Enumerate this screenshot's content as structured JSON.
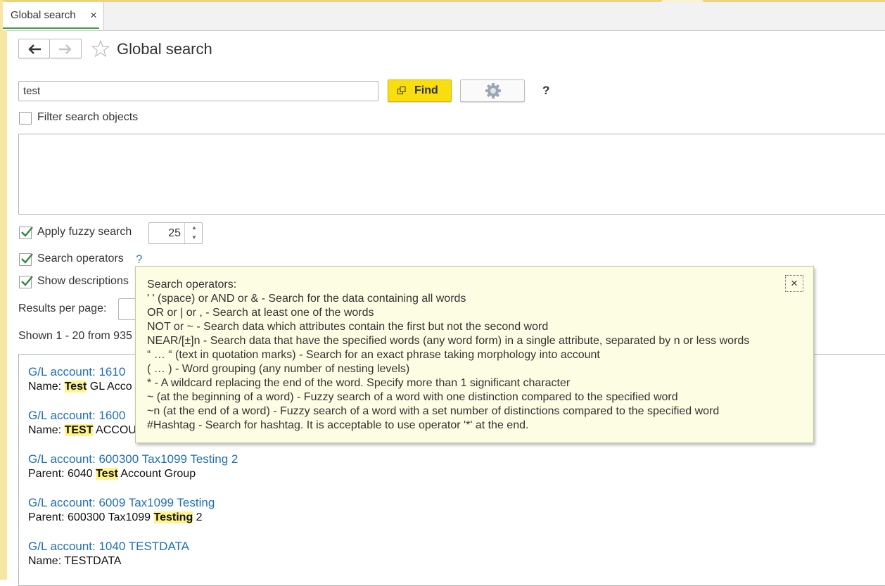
{
  "tab": {
    "label": "Global search",
    "close": "×"
  },
  "nav": {
    "back": "back-arrow",
    "forward": "forward-arrow"
  },
  "page": {
    "title": "Global search"
  },
  "search": {
    "value": "test",
    "find_label": "Find",
    "help": "?"
  },
  "filter": {
    "label": "Filter search objects",
    "checked": false
  },
  "fuzzy": {
    "label": "Apply fuzzy search",
    "checked": true,
    "value": "25"
  },
  "operators": {
    "label": "Search operators",
    "checked": true,
    "help": "?"
  },
  "descriptions": {
    "label": "Show descriptions",
    "checked": true
  },
  "results_per_page": {
    "label": "Results per page:"
  },
  "shown": {
    "text": "Shown 1 - 20 from 935"
  },
  "results": [
    {
      "title": "G/L account: 1610",
      "prefix": "Name: ",
      "highlight": "Test",
      "suffix": " GL Acco"
    },
    {
      "title": "G/L account: 1600",
      "prefix": "Name: ",
      "highlight": "TEST",
      "suffix": " ACCOU"
    },
    {
      "title": "G/L account: 600300 Tax1099 Testing 2",
      "prefix": "Parent: 6040 ",
      "highlight": "Test",
      "suffix": " Account Group"
    },
    {
      "title": "G/L account: 6009 Tax1099 Testing",
      "prefix": "Parent: 600300 Tax1099 ",
      "highlight": "Testing",
      "suffix": " 2"
    },
    {
      "title": "G/L account: 1040 TESTDATA",
      "prefix": "Name: TESTDATA",
      "highlight": "",
      "suffix": ""
    }
  ],
  "tooltip": {
    "close": "×",
    "lines": [
      "Search operators:",
      "' ' (space) or AND or & - Search for the data containing all words",
      "OR or | or , - Search at least one of the words",
      "NOT or ~ - Search data which attributes contain the first but not the second word",
      "NEAR/[±]n - Search data that have the specified words (any word form) in a single attribute, separated by n or less words",
      "“ … “ (text in quotation marks) - Search for an exact phrase taking morphology into account",
      "( … ) - Word grouping (any number of nesting levels)",
      "* - A wildcard replacing the end of the word. Specify more than 1 significant character",
      "~ (at the beginning of a word) - Fuzzy search of a word with one distinction compared to the specified word",
      "~n (at the end of a word) - Fuzzy search of a word with a set number of distinctions compared to the specified word",
      "#Hashtag - Search for hashtag. It is acceptable to use operator '*' at the end."
    ]
  },
  "colors": {
    "accent": "#f8de0e",
    "link": "#1e6fb8",
    "highlight": "#fff38c",
    "check": "#2f8a3a",
    "tooltip_bg": "#fdfde4"
  }
}
